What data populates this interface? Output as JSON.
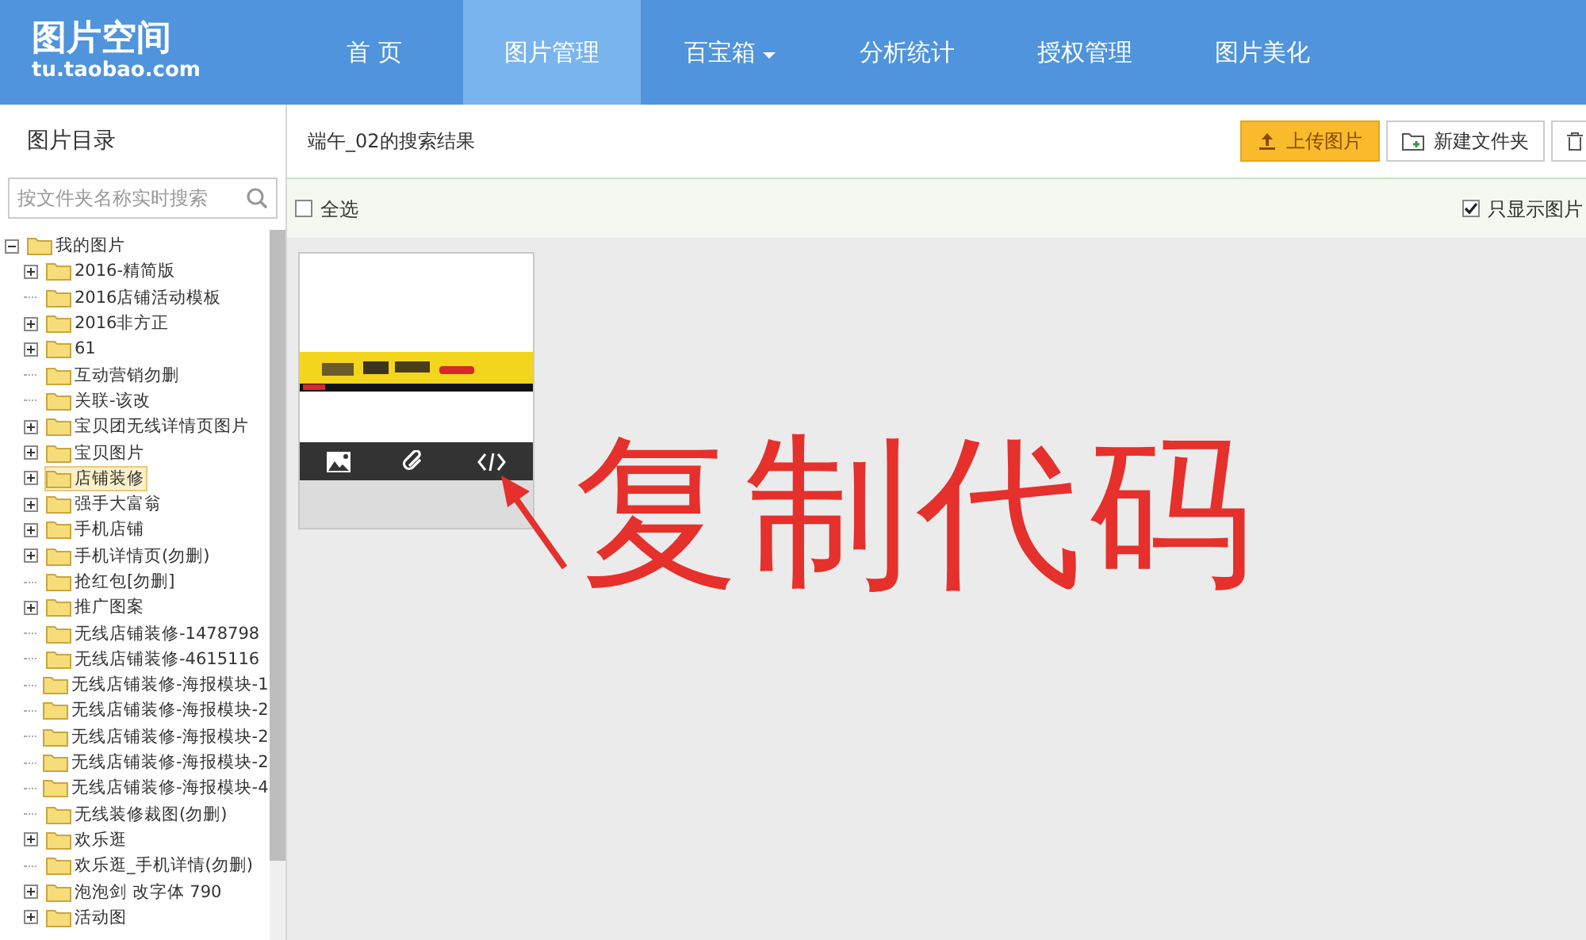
{
  "header": {
    "logo_title": "图片空间",
    "logo_subtitle": "tu.taobao.com",
    "nav": [
      {
        "label": "首 页",
        "selected": false,
        "dropdown": false
      },
      {
        "label": "图片管理",
        "selected": true,
        "dropdown": false
      },
      {
        "label": "百宝箱",
        "selected": false,
        "dropdown": true
      },
      {
        "label": "分析统计",
        "selected": false,
        "dropdown": false
      },
      {
        "label": "授权管理",
        "selected": false,
        "dropdown": false
      },
      {
        "label": "图片美化",
        "selected": false,
        "dropdown": false
      }
    ]
  },
  "sidebar": {
    "title": "图片目录",
    "search": {
      "placeholder": "按文件夹名称实时搜索"
    },
    "tree": [
      {
        "label": "我的图片",
        "expanded": true,
        "selected": false,
        "children": [
          {
            "label": "2016-精简版",
            "expandable": true,
            "selected": false
          },
          {
            "label": "2016店铺活动模板",
            "expandable": false,
            "selected": false
          },
          {
            "label": "2016非方正",
            "expandable": true,
            "selected": false
          },
          {
            "label": "61",
            "expandable": true,
            "selected": false
          },
          {
            "label": "互动营销勿删",
            "expandable": false,
            "selected": false
          },
          {
            "label": "关联-该改",
            "expandable": false,
            "selected": false
          },
          {
            "label": "宝贝团无线详情页图片",
            "expandable": true,
            "selected": false
          },
          {
            "label": "宝贝图片",
            "expandable": true,
            "selected": false
          },
          {
            "label": "店铺装修",
            "expandable": true,
            "selected": true
          },
          {
            "label": "强手大富翁",
            "expandable": true,
            "selected": false
          },
          {
            "label": "手机店铺",
            "expandable": true,
            "selected": false
          },
          {
            "label": "手机详情页(勿删)",
            "expandable": true,
            "selected": false
          },
          {
            "label": "抢红包[勿删]",
            "expandable": false,
            "selected": false
          },
          {
            "label": "推广图案",
            "expandable": true,
            "selected": false
          },
          {
            "label": "无线店铺装修-1478798",
            "expandable": false,
            "selected": false
          },
          {
            "label": "无线店铺装修-4615116",
            "expandable": false,
            "selected": false
          },
          {
            "label": "无线店铺装修-海报模块-1",
            "expandable": false,
            "selected": false
          },
          {
            "label": "无线店铺装修-海报模块-2",
            "expandable": false,
            "selected": false
          },
          {
            "label": "无线店铺装修-海报模块-2",
            "expandable": false,
            "selected": false
          },
          {
            "label": "无线店铺装修-海报模块-2",
            "expandable": false,
            "selected": false
          },
          {
            "label": "无线店铺装修-海报模块-4",
            "expandable": false,
            "selected": false
          },
          {
            "label": "无线装修裁图(勿删)",
            "expandable": false,
            "selected": false
          },
          {
            "label": "欢乐逛",
            "expandable": true,
            "selected": false
          },
          {
            "label": "欢乐逛_手机详情(勿删)",
            "expandable": false,
            "selected": false
          },
          {
            "label": "泡泡剑 改字体 790",
            "expandable": true,
            "selected": false
          },
          {
            "label": "活动图",
            "expandable": true,
            "selected": false
          }
        ]
      }
    ]
  },
  "main": {
    "result_title": "端午_02的搜索结果",
    "buttons": [
      {
        "label": "上传图片",
        "kind": "primary"
      },
      {
        "label": "新建文件夹",
        "kind": "folder"
      },
      {
        "kind": "delete"
      }
    ],
    "select_all": {
      "label": "全选",
      "checked": false
    },
    "images_only": {
      "label": "只显示图片",
      "checked": true
    },
    "annotation": "复制代码"
  }
}
